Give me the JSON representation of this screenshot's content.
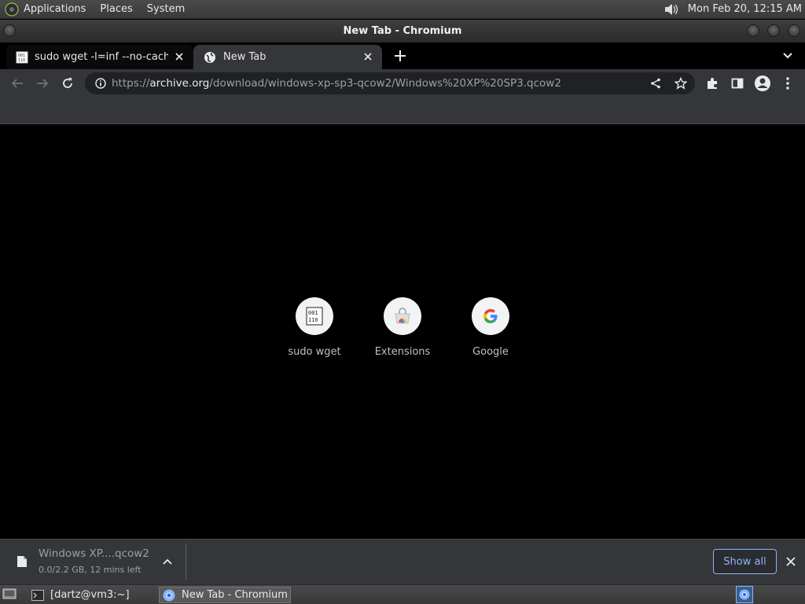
{
  "colors": {
    "accent": "#8ab4f8",
    "toolbar": "#35363a",
    "omnibox": "#202124",
    "content": "#000000"
  },
  "panel": {
    "menus": [
      "Applications",
      "Places",
      "System"
    ],
    "clock": "Mon Feb 20, 12:15 AM",
    "volume_icon": "speaker-icon"
  },
  "window": {
    "title": "New Tab - Chromium"
  },
  "tabs": [
    {
      "label": "sudo wget -l=inf --no-cache -",
      "icon": "binary-file-icon",
      "active": false
    },
    {
      "label": "New Tab",
      "icon": "globe-icon",
      "active": true
    }
  ],
  "omnibox": {
    "scheme": "https://",
    "host": "archive.org",
    "path": "/download/windows-xp-sp3-qcow2/Windows%20XP%20SP3.qcow2"
  },
  "shortcuts": [
    {
      "label": "sudo wget",
      "icon": "binary-file-icon"
    },
    {
      "label": "Extensions",
      "icon": "web-store-icon"
    },
    {
      "label": "Google",
      "icon": "google-g-icon"
    }
  ],
  "download": {
    "filename": "Windows XP....qcow2",
    "status": "0.0/2.2 GB, 12 mins left",
    "show_all_label": "Show all"
  },
  "taskbar": {
    "terminal_label": "[dartz@vm3:~]",
    "browser_label": "New Tab - Chromium"
  }
}
